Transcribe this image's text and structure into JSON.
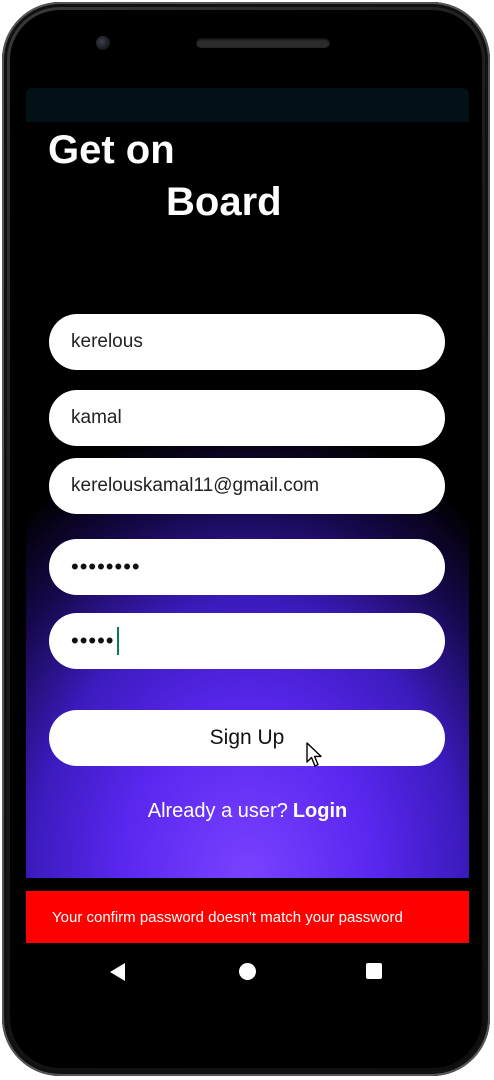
{
  "header": {
    "title_line1": "Get on",
    "title_line2": "Board"
  },
  "form": {
    "first_name": "kerelous",
    "last_name": "kamal",
    "email": "kerelouskamal11@gmail.com",
    "password_masked": "••••••••",
    "confirm_password_masked": "•••••"
  },
  "actions": {
    "signup_label": "Sign Up",
    "login_prompt": "Already a user?",
    "login_link": "Login"
  },
  "snackbar": {
    "message": "Your confirm password doesn't match your password"
  },
  "icons": {
    "nav_back": "back-icon",
    "nav_home": "home-icon",
    "nav_recent": "recent-apps-icon"
  },
  "colors": {
    "accent_purple": "#5a27f0",
    "error_red": "#ff0000",
    "caret_green": "#0b7a55"
  }
}
